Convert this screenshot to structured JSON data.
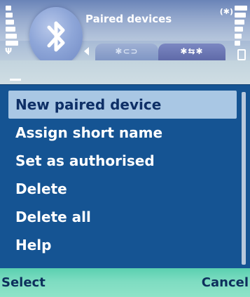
{
  "header": {
    "title": "Paired devices",
    "status_indicator": "(✱)",
    "app_icon": "bluetooth-icon",
    "tabs": [
      {
        "icon": "bluetooth-settings-icon",
        "glyph": "✱⊂⊃",
        "active": false
      },
      {
        "icon": "bluetooth-paired-devices-icon",
        "glyph": "✱⇆✱",
        "active": true
      }
    ]
  },
  "menu": {
    "items": [
      {
        "label": "New paired device",
        "selected": true
      },
      {
        "label": "Assign short name",
        "selected": false
      },
      {
        "label": "Set as authorised",
        "selected": false
      },
      {
        "label": "Delete",
        "selected": false
      },
      {
        "label": "Delete all",
        "selected": false
      },
      {
        "label": "Help",
        "selected": false
      }
    ]
  },
  "softkeys": {
    "left": "Select",
    "right": "Cancel"
  },
  "colors": {
    "menu_bg": "#155493",
    "highlight": "#a9c7e4",
    "softkey_bg": "#7edcc1",
    "header_top": "#6a84b8"
  }
}
